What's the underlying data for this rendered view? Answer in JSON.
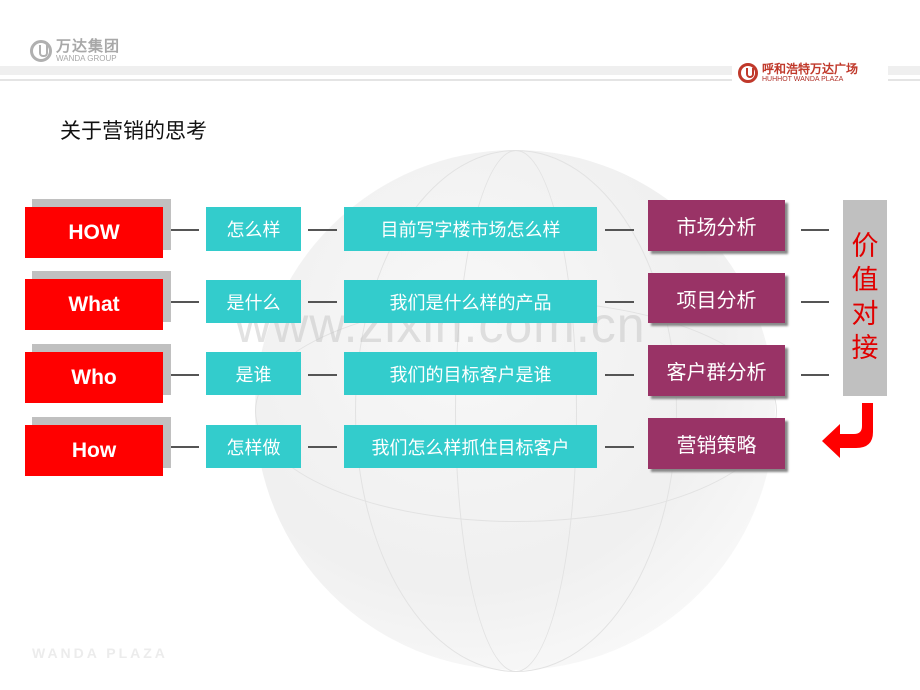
{
  "header": {
    "left_logo": {
      "cn": "万达集团",
      "en": "WANDA GROUP"
    },
    "right_logo": {
      "cn": "呼和浩特万达广场",
      "en": "HUHHOT WANDA PLAZA"
    }
  },
  "watermark": "www.zixin.com.cn",
  "footer_mark": "WANDA PLAZA",
  "title": "关于营销的思考",
  "rows": [
    {
      "key": "HOW",
      "question": "怎么样",
      "detail": "目前写字楼市场怎么样",
      "analysis": "市场分析"
    },
    {
      "key": "What",
      "question": "是什么",
      "detail": "我们是什么样的产品",
      "analysis": "项目分析"
    },
    {
      "key": "Who",
      "question": "是谁",
      "detail": "我们的目标客户是谁",
      "analysis": "客户群分析"
    },
    {
      "key": "How",
      "question": "怎样做",
      "detail": "我们怎么样抓住目标客户",
      "analysis": "营销策略"
    }
  ],
  "value_bar": [
    "价",
    "值",
    "对",
    "接"
  ],
  "colors": {
    "key_box": "#ff0000",
    "question_box": "#33cccc",
    "analysis_box": "#993366",
    "value_bar": "#c0c0c0",
    "value_text": "#e00000",
    "arrow": "#ff0000"
  },
  "icons": {
    "arrow": "curved-arrow-down-left"
  }
}
